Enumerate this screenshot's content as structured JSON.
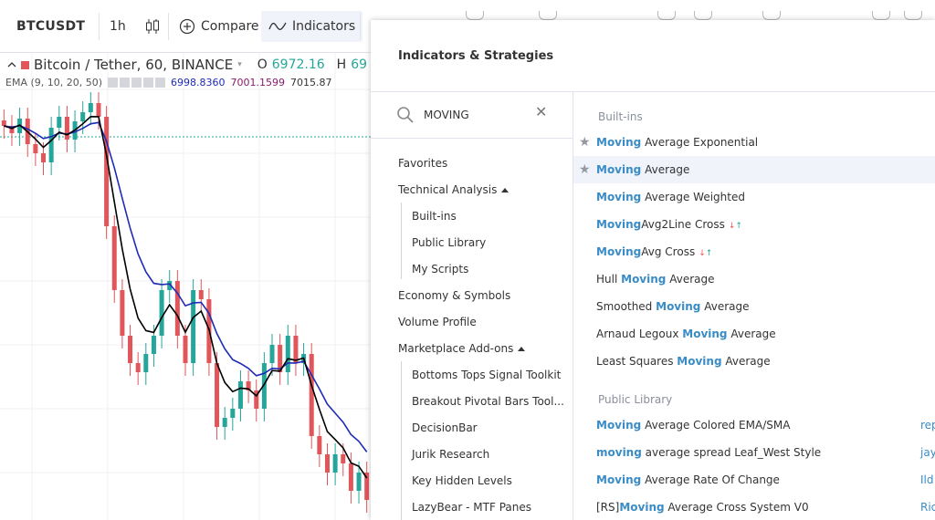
{
  "toolbar": {
    "symbol": "BTCUSDT",
    "interval": "1h",
    "compare_label": "Compare",
    "indicators_label": "Indicators"
  },
  "chart": {
    "title": "Bitcoin / Tether, 60, BINANCE",
    "open_label": "O",
    "open_value": "6972.16",
    "high_label": "H",
    "high_value": "69",
    "ema_label": "EMA (9, 10, 20, 50)",
    "ema_value_1": "6998.8360",
    "ema_value_2": "7001.1599",
    "ema_value_3": "7015.87",
    "colors": {
      "up": "#26a69a",
      "down": "#e0565b",
      "ema_fast": "#000000",
      "ema_slow": "#1f2bb5"
    }
  },
  "dialog": {
    "title": "Indicators & Strategies",
    "search": {
      "value": "MOVING"
    },
    "nav": {
      "favorites": "Favorites",
      "technical_analysis": "Technical Analysis",
      "built_ins": "Built-ins",
      "public_library": "Public Library",
      "my_scripts": "My Scripts",
      "economy_symbols": "Economy & Symbols",
      "volume_profile": "Volume Profile",
      "marketplace_addons": "Marketplace Add-ons",
      "addons": [
        "Bottoms Tops Signal Toolkit",
        "Breakout Pivotal Bars Tool...",
        "DecisionBar",
        "Jurik Research",
        "Key Hidden Levels",
        "LazyBear - MTF Panes"
      ]
    },
    "builtins_heading": "Built-ins",
    "builtins": [
      {
        "pre": "",
        "hl": "Moving",
        "post": " Average Exponential",
        "starred": true
      },
      {
        "pre": "",
        "hl": "Moving",
        "post": " Average",
        "starred": true
      },
      {
        "pre": "",
        "hl": "Moving",
        "post": " Average Weighted",
        "starred": false
      },
      {
        "pre": "",
        "hl": "Moving",
        "post": "Avg2Line Cross",
        "starred": false
      },
      {
        "pre": "",
        "hl": "Moving",
        "post": "Avg Cross",
        "starred": false
      },
      {
        "pre": "Hull ",
        "hl": "Moving",
        "post": " Average",
        "starred": false
      },
      {
        "pre": "Smoothed ",
        "hl": "Moving",
        "post": " Average",
        "starred": false
      },
      {
        "pre": "Arnaud Legoux ",
        "hl": "Moving",
        "post": " Average",
        "starred": false
      },
      {
        "pre": "Least Squares ",
        "hl": "Moving",
        "post": " Average",
        "starred": false
      }
    ],
    "public_heading": "Public Library",
    "public": [
      {
        "pre": "",
        "hl": "Moving",
        "post": " Average Colored EMA/SMA",
        "author": "rep"
      },
      {
        "pre": "",
        "hl": "moving",
        "post": " average spread Leaf_West Style",
        "author": "jay"
      },
      {
        "pre": "",
        "hl": "Moving",
        "post": " Average Rate Of Change",
        "author": "Ild"
      },
      {
        "pre": "[RS]",
        "hl": "Moving",
        "post": " Average Cross System V0",
        "author": "Ric"
      }
    ]
  }
}
